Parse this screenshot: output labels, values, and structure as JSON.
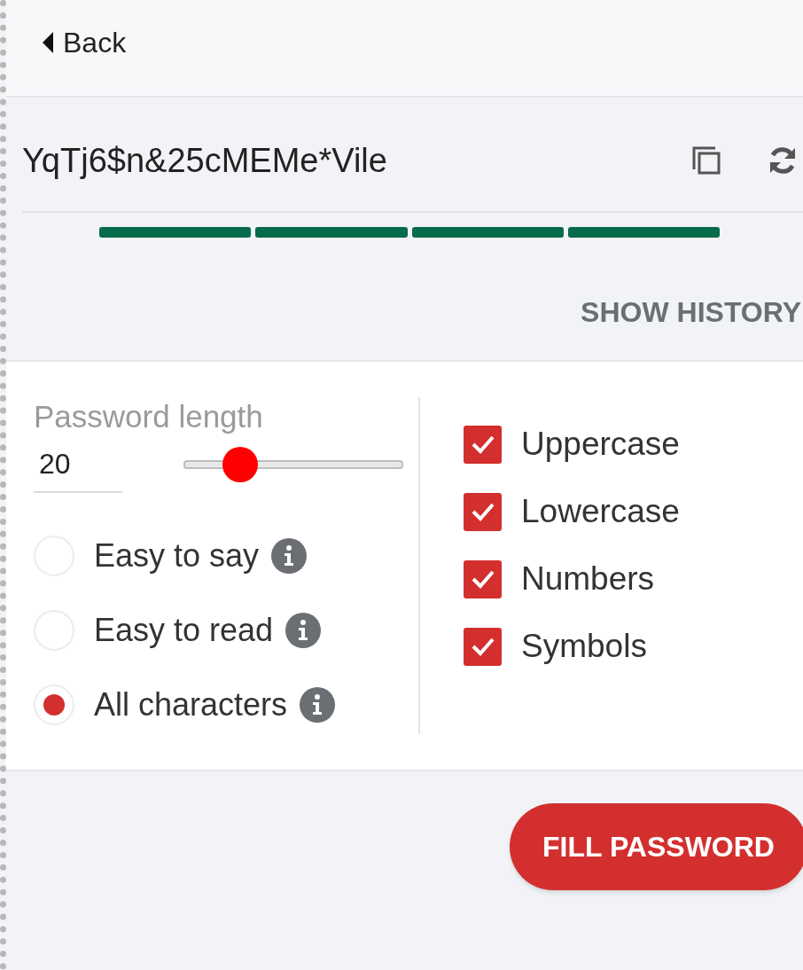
{
  "back": {
    "label": "Back"
  },
  "password": {
    "value": "YqTj6$n&25cMEMe*Vile"
  },
  "strength_segments": [
    {
      "filled": true
    },
    {
      "filled": true
    },
    {
      "filled": true
    },
    {
      "filled": true
    }
  ],
  "show_history": "SHOW HISTORY",
  "length": {
    "label": "Password length",
    "value": "20",
    "level": 0.26
  },
  "modes": [
    {
      "label": "Easy to say",
      "selected": false
    },
    {
      "label": "Easy to read",
      "selected": false
    },
    {
      "label": "All characters",
      "selected": true
    }
  ],
  "options": [
    {
      "label": "Uppercase",
      "checked": true
    },
    {
      "label": "Lowercase",
      "checked": true
    },
    {
      "label": "Numbers",
      "checked": true
    },
    {
      "label": "Symbols",
      "checked": true
    }
  ],
  "fill_button": "FILL PASSWORD"
}
